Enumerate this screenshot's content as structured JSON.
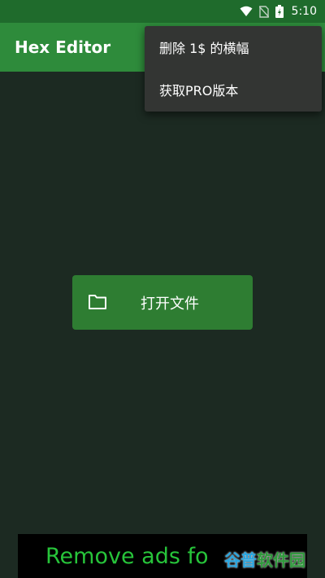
{
  "status_bar": {
    "time": "5:10",
    "icons": [
      "wifi-icon",
      "no-sim-icon",
      "battery-charging-icon"
    ]
  },
  "app_bar": {
    "title": "Hex Editor"
  },
  "overflow_menu": {
    "items": [
      {
        "label": "删除 1$ 的横幅"
      },
      {
        "label": "获取PRO版本"
      }
    ]
  },
  "main": {
    "open_file_button": {
      "label": "打开文件",
      "icon": "folder-icon"
    }
  },
  "ad_banner": {
    "text": "Remove ads fo"
  },
  "watermark": {
    "part1": "谷普",
    "part2": "软件园"
  },
  "colors": {
    "status_bar": "#1f6b2c",
    "app_bar": "#2e8b3b",
    "background": "#1c2a22",
    "button": "#2e7d32",
    "menu": "#333533",
    "ad_text": "#27c43a"
  }
}
